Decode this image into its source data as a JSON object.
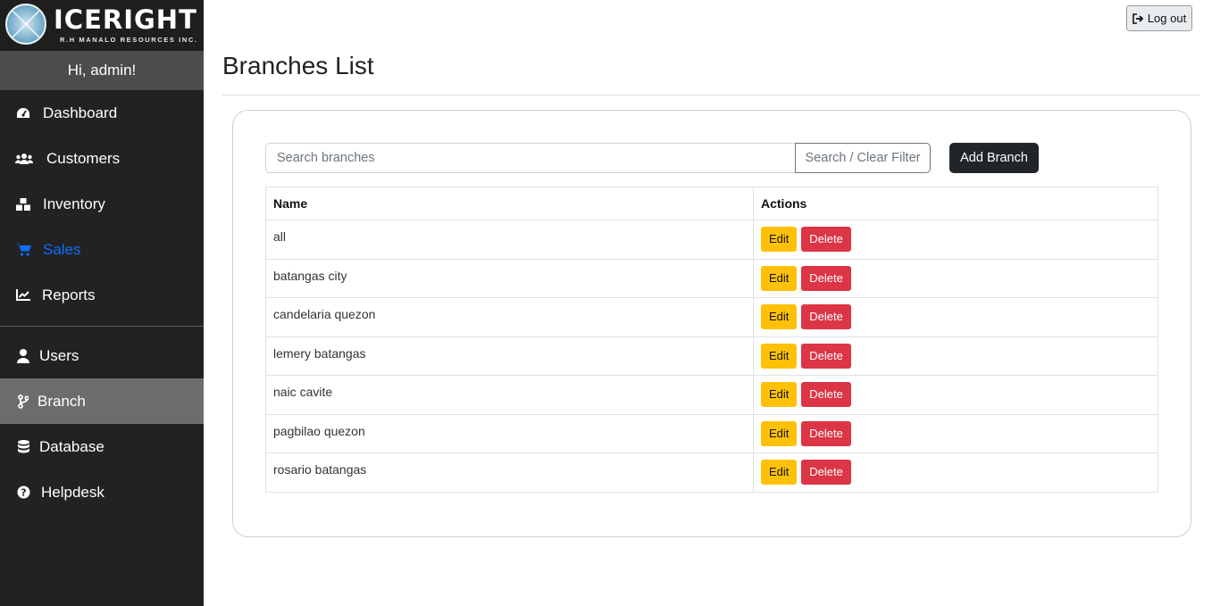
{
  "brand": {
    "name": "ICERIGHT",
    "tagline": "R.H MANALO RESOURCES INC."
  },
  "greeting": "Hi, admin!",
  "sidebar": {
    "items": [
      {
        "label": "Dashboard",
        "icon": "tachometer-icon"
      },
      {
        "label": "Customers",
        "icon": "users-icon"
      },
      {
        "label": "Inventory",
        "icon": "boxes-icon"
      },
      {
        "label": "Sales",
        "icon": "cart-icon"
      },
      {
        "label": "Reports",
        "icon": "chart-line-icon"
      },
      {
        "label": "Users",
        "icon": "user-icon"
      },
      {
        "label": "Branch",
        "icon": "branch-icon"
      },
      {
        "label": "Database",
        "icon": "database-icon"
      },
      {
        "label": "Helpdesk",
        "icon": "question-circle-icon"
      }
    ],
    "highlighted_item": "Sales",
    "selected_item": "Branch"
  },
  "header": {
    "logout_label": "Log out",
    "logout_icon": "sign-out-icon"
  },
  "page": {
    "title": "Branches List"
  },
  "search": {
    "placeholder": "Search branches",
    "value": "",
    "button_label": "Search / Clear Filter"
  },
  "add_button_label": "Add Branch",
  "table": {
    "columns": [
      "Name",
      "Actions"
    ],
    "edit_label": "Edit",
    "delete_label": "Delete",
    "rows": [
      "all",
      "batangas city",
      "candelaria quezon",
      "lemery batangas",
      "naic cavite",
      "pagbilao quezon",
      "rosario batangas"
    ]
  },
  "colors": {
    "sidebar_bg": "#222222",
    "active_link": "#0d6efd",
    "edit": "#ffc107",
    "delete": "#dc3545",
    "primary_dark": "#212529"
  }
}
